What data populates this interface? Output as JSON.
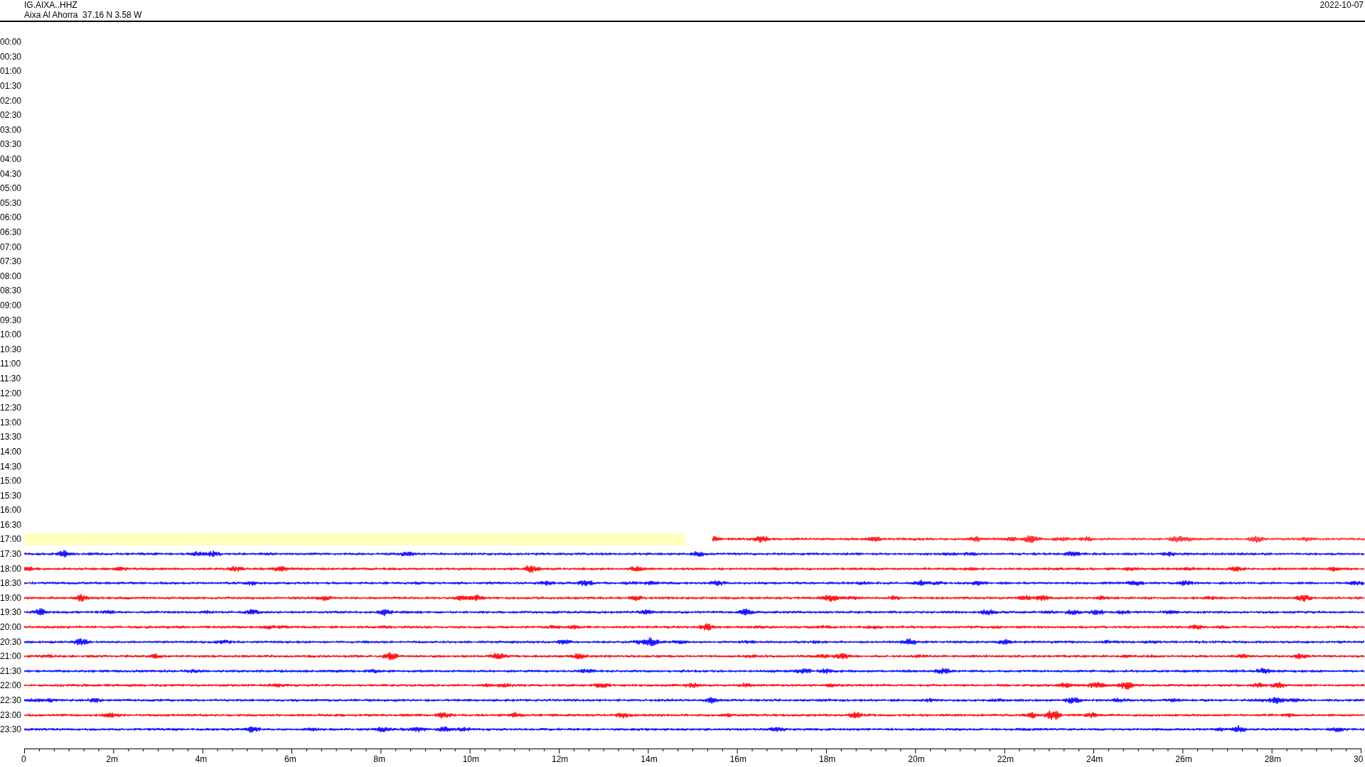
{
  "header": {
    "station": "IG.AIXA..HHZ",
    "location": "Aixa Al Ahorra  37.16 N 3.58 W",
    "date": "2022-10-07"
  },
  "rows": [
    {
      "label": "00:00",
      "kind": "empty"
    },
    {
      "label": "00:30",
      "kind": "empty"
    },
    {
      "label": "01:00",
      "kind": "empty"
    },
    {
      "label": "01:30",
      "kind": "empty"
    },
    {
      "label": "02:00",
      "kind": "empty"
    },
    {
      "label": "02:30",
      "kind": "empty"
    },
    {
      "label": "03:00",
      "kind": "empty"
    },
    {
      "label": "03:30",
      "kind": "empty"
    },
    {
      "label": "04:00",
      "kind": "empty"
    },
    {
      "label": "04:30",
      "kind": "empty"
    },
    {
      "label": "05:00",
      "kind": "empty"
    },
    {
      "label": "05:30",
      "kind": "empty"
    },
    {
      "label": "06:00",
      "kind": "empty"
    },
    {
      "label": "06:30",
      "kind": "empty"
    },
    {
      "label": "07:00",
      "kind": "empty"
    },
    {
      "label": "07:30",
      "kind": "empty"
    },
    {
      "label": "08:00",
      "kind": "empty"
    },
    {
      "label": "08:30",
      "kind": "empty"
    },
    {
      "label": "09:00",
      "kind": "empty"
    },
    {
      "label": "09:30",
      "kind": "empty"
    },
    {
      "label": "10:00",
      "kind": "empty"
    },
    {
      "label": "10:30",
      "kind": "empty"
    },
    {
      "label": "11:00",
      "kind": "empty"
    },
    {
      "label": "11:30",
      "kind": "empty"
    },
    {
      "label": "12:00",
      "kind": "empty"
    },
    {
      "label": "12:30",
      "kind": "empty"
    },
    {
      "label": "13:00",
      "kind": "empty"
    },
    {
      "label": "13:30",
      "kind": "empty"
    },
    {
      "label": "14:00",
      "kind": "empty"
    },
    {
      "label": "14:30",
      "kind": "empty"
    },
    {
      "label": "15:00",
      "kind": "empty"
    },
    {
      "label": "15:30",
      "kind": "empty"
    },
    {
      "label": "16:00",
      "kind": "empty"
    },
    {
      "label": "16:30",
      "kind": "empty"
    },
    {
      "label": "17:00",
      "kind": "partial",
      "color": "#ff0000"
    },
    {
      "label": "17:30",
      "kind": "trace",
      "color": "#0000ff"
    },
    {
      "label": "18:00",
      "kind": "trace",
      "color": "#ff0000"
    },
    {
      "label": "18:30",
      "kind": "trace",
      "color": "#0000ff"
    },
    {
      "label": "19:00",
      "kind": "trace",
      "color": "#ff0000"
    },
    {
      "label": "19:30",
      "kind": "trace",
      "color": "#0000ff"
    },
    {
      "label": "20:00",
      "kind": "trace",
      "color": "#ff0000"
    },
    {
      "label": "20:30",
      "kind": "trace",
      "color": "#0000ff"
    },
    {
      "label": "21:00",
      "kind": "trace",
      "color": "#ff0000"
    },
    {
      "label": "21:30",
      "kind": "trace",
      "color": "#0000ff"
    },
    {
      "label": "22:00",
      "kind": "trace",
      "color": "#ff0000"
    },
    {
      "label": "22:30",
      "kind": "trace",
      "color": "#0000ff"
    },
    {
      "label": "23:00",
      "kind": "trace",
      "color": "#ff0000"
    },
    {
      "label": "23:30",
      "kind": "trace",
      "color": "#0000ff"
    }
  ],
  "x_axis": {
    "labels": [
      "0",
      "2m",
      "4m",
      "6m",
      "8m",
      "10m",
      "12m",
      "14m",
      "16m",
      "18m",
      "20m",
      "22m",
      "24m",
      "26m",
      "28m",
      "30"
    ]
  }
}
